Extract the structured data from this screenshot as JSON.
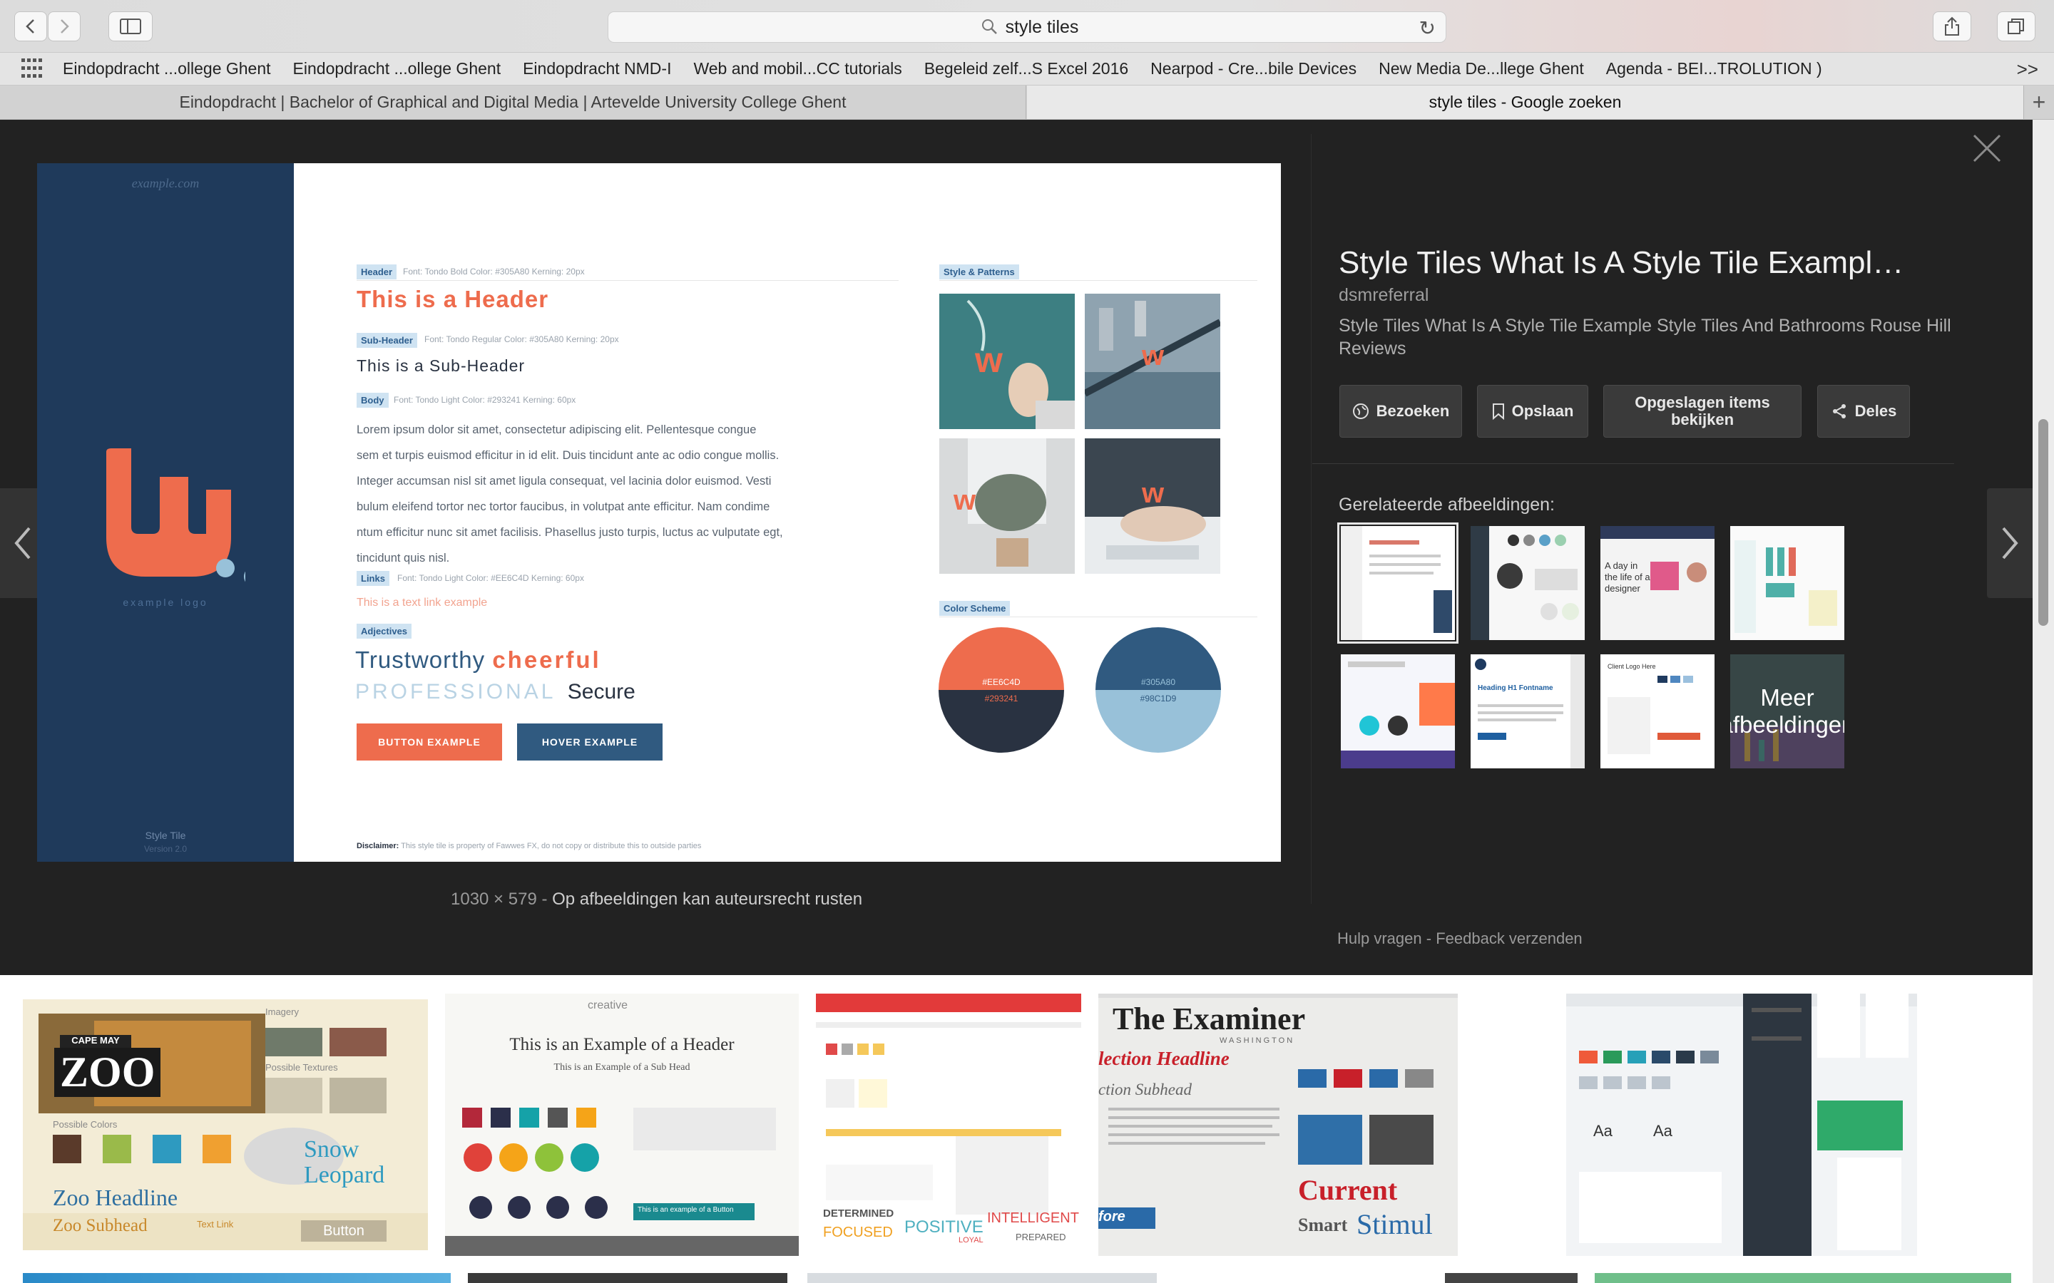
{
  "address": {
    "query": "style tiles"
  },
  "bookmarks": [
    "Eindopdracht ...ollege Ghent",
    "Eindopdracht ...ollege Ghent",
    "Eindopdracht NMD-I",
    "Web and mobil...CC tutorials",
    "Begeleid zelf...S Excel 2016",
    "Nearpod - Cre...bile Devices",
    "New Media De...llege Ghent",
    "Agenda - BEI...TROLUTION )"
  ],
  "tabs": [
    {
      "title": "Eindopdracht | Bachelor of Graphical and Digital Media | Artevelde University College Ghent",
      "active": false
    },
    {
      "title": "style tiles - Google zoeken",
      "active": true
    }
  ],
  "preview": {
    "site": "example.com",
    "logo_text": "example logo",
    "tile_label": "Style Tile",
    "tile_version": "Version 2.0",
    "header_tag": "Header",
    "header_meta": "Font: Tondo Bold  Color: #305A80  Kerning: 20px",
    "header_text": "This is a Header",
    "sub_tag": "Sub-Header",
    "sub_meta": "Font: Tondo Regular  Color: #305A80  Kerning: 20px",
    "sub_text": "This is a Sub-Header",
    "body_tag": "Body",
    "body_meta": "Font: Tondo Light  Color: #293241  Kerning: 60px",
    "body_lines": [
      "Lorem ipsum dolor sit amet, consectetur adipiscing elit. Pellentesque congue",
      "sem et turpis euismod efficitur in id elit. Duis tincidunt ante ac odio congue mollis.",
      "Integer accumsan nisl sit amet ligula consequat, vel lacinia dolor euismod. Vesti",
      "bulum eleifend tortor nec tortor faucibus, in volutpat ante efficitur. Nam condime",
      "ntum efficitur nunc sit amet facilisis. Phasellus justo turpis, luctus ac vulputate egt,",
      "tincidunt quis nisl."
    ],
    "links_tag": "Links",
    "links_meta": "Font: Tondo Light  Color: #EE6C4D  Kerning: 60px",
    "link_text": "This is a text link example",
    "adj_tag": "Adjectives",
    "adj_1": "Trustworthy",
    "adj_2": "cheerful",
    "adj_3": "PROFESSIONAL",
    "adj_4": "Secure",
    "btn_1": "BUTTON EXAMPLE",
    "btn_2": "HOVER EXAMPLE",
    "patterns_tag": "Style & Patterns",
    "scheme_tag": "Color Scheme",
    "swatch_1_top": "#EE6C4D",
    "swatch_1_bottom": "#293241",
    "swatch_2_top": "#305A80",
    "swatch_2_bottom": "#98C1D9",
    "disclaimer_bold": "Disclaimer:",
    "disclaimer": " This style tile is property of Fawwes FX, do not copy or distribute this to outside parties",
    "colors": {
      "orange": "#EE6C4D",
      "navy": "#293241",
      "blue": "#305A80",
      "light_blue": "#98C1D9"
    }
  },
  "info": {
    "title": "Style Tiles What Is A Style Tile Exampl…",
    "source": "dsmreferral",
    "description": "Style Tiles What Is A Style Tile Example Style Tiles And Bathrooms Rouse Hill Reviews",
    "actions": [
      "Bezoeken",
      "Opslaan",
      "Opgeslagen items bekijken",
      "Deles"
    ],
    "related_title": "Gerelateerde afbeeldingen:",
    "more_label": "Meer afbeeldingen",
    "dimensions": "1030 × 579",
    "copyright": "Op afbeeldingen kan auteursrecht rusten",
    "help": "Hulp vragen",
    "feedback": "Feedback verzenden"
  },
  "results": {
    "zoo_headline": "Zoo Headline",
    "zoo_subhead": "Zoo Subhead",
    "zoo_title": "ZOO",
    "zoo_county": "CAPE MAY COUNTY",
    "snow": "Snow",
    "leopard": "Leopard",
    "button": "Button",
    "possible_colors": "Possible Colors",
    "imagery": "Imagery",
    "possible_textures": "Possible Textures",
    "text_link": "Text Link",
    "ex_brand": "creative",
    "ex_header": "This is an Example of a Header",
    "ex_sub": "This is an Example of a Sub Head",
    "ex_btn": "This is an example of a Button",
    "words_1": "DETERMINED",
    "words_2": "FOCUSED",
    "words_3": "POSITIVE",
    "words_4": "INTELLIGENT",
    "words_5": "PREPARED",
    "words_6": "LOYAL",
    "examiner": "The Examiner",
    "examiner_city": "WASHINGTON",
    "selection_headline": "lection Headline",
    "selection_subhead": "ction Subhead",
    "current": "Current",
    "smart": "Smart",
    "stimul": "Stimul",
    "more": "fore",
    "aa": "Aa"
  }
}
